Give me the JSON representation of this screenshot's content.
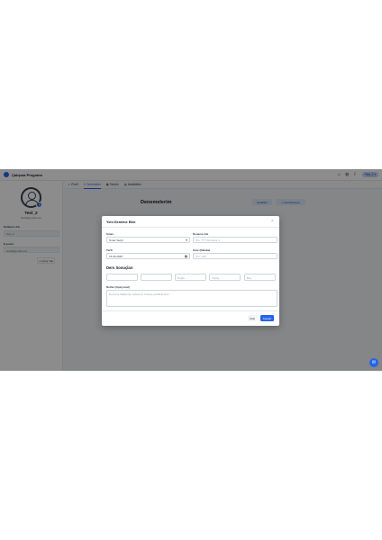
{
  "app": {
    "title": "Çalışma Programı"
  },
  "topbar": {
    "icons": [
      "home-icon",
      "globe-icon",
      "moon-icon",
      "grid-icon"
    ],
    "user_chip": "Test_2"
  },
  "sidebar": {
    "username": "Test_2",
    "email": "test2@gmail.com",
    "username_label": "Kullanıcı Adı",
    "username_value": "Test_2",
    "email_label": "E-posta",
    "email_value": "test2@gmail.com",
    "logout_label": "Çıkış Yap"
  },
  "tabs": [
    {
      "label": "Profil",
      "icon": "user-icon"
    },
    {
      "label": "Denemeler",
      "icon": "edit-icon",
      "active": true
    },
    {
      "label": "Takvim",
      "icon": "calendar-icon"
    },
    {
      "label": "İstatistikler",
      "icon": "chart-icon"
    }
  ],
  "page": {
    "title": "Denemelerim",
    "btn_secondary": "Hedefleri",
    "btn_primary": "Yeni Deneme"
  },
  "modal": {
    "title": "Yeni Deneme Ekle",
    "close": "×",
    "fields": {
      "type_label": "Sınav",
      "type_value": "Sınav Seçin",
      "name_label": "Deneme Adı",
      "name_placeholder": "Örn: TYT Deneme 1",
      "date_label": "Tarih",
      "date_value": "15.06.2025",
      "duration_label": "Süre (Dakika)",
      "duration_placeholder": "Örn: 120"
    },
    "results_title": "Ders Sonuçları",
    "results": [
      {
        "placeholder": ""
      },
      {
        "placeholder": ""
      },
      {
        "placeholder": "Doğru"
      },
      {
        "placeholder": "Yanlış"
      },
      {
        "placeholder": "Boş"
      }
    ],
    "notes_label": "Notlar (Opsiyonel)",
    "notes_placeholder": "Deneme hakkında notlarınızı buraya yazabilirsiniz...",
    "cancel": "İptal",
    "save": "Kaydet"
  }
}
